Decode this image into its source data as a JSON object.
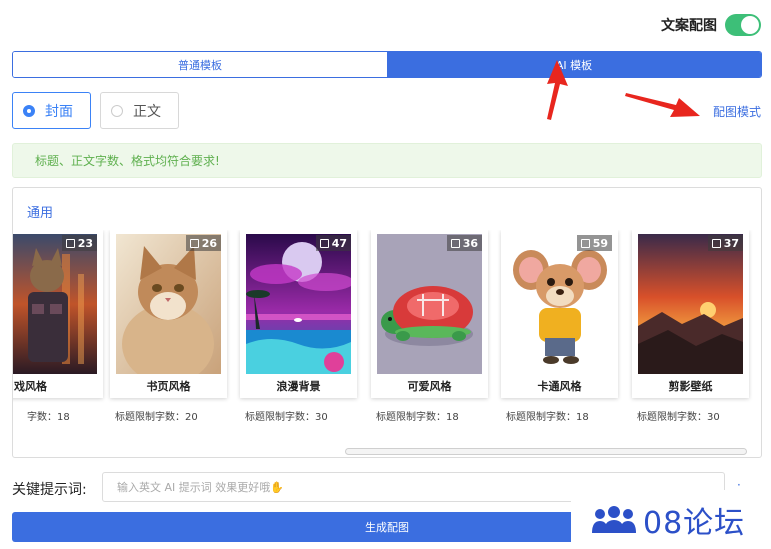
{
  "header": {
    "toggle_label": "文案配图",
    "toggle_on": true
  },
  "tabs": [
    {
      "label": "普通模板",
      "active": false
    },
    {
      "label": "AI 模板",
      "active": true
    }
  ],
  "radios": [
    {
      "label": "封面",
      "selected": true
    },
    {
      "label": "正文",
      "selected": false
    }
  ],
  "mode_link": "配图模式",
  "alert": "标题、正文字数、格式均符合要求!",
  "panel": {
    "title": "通用",
    "cards": [
      {
        "name": "戏风格",
        "count": "23",
        "limit": "字数：18"
      },
      {
        "name": "书页风格",
        "count": "26",
        "limit": "标题限制字数：20"
      },
      {
        "name": "浪漫背景",
        "count": "47",
        "limit": "标题限制字数：30"
      },
      {
        "name": "可爱风格",
        "count": "36",
        "limit": "标题限制字数：18"
      },
      {
        "name": "卡通风格",
        "count": "59",
        "limit": "标题限制字数：18"
      },
      {
        "name": "剪影壁纸",
        "count": "37",
        "limit": "标题限制字数：30"
      }
    ]
  },
  "keyword": {
    "label": "关键提示词:",
    "placeholder": "输入英文 AI 提示词 效果更好哦✋"
  },
  "generate_button": "生成配图",
  "watermark": "08论坛",
  "colors": {
    "primary": "#3b6ee0",
    "success": "#5fb04f",
    "toggle": "#3dbf78",
    "arrow": "#e8261e"
  }
}
